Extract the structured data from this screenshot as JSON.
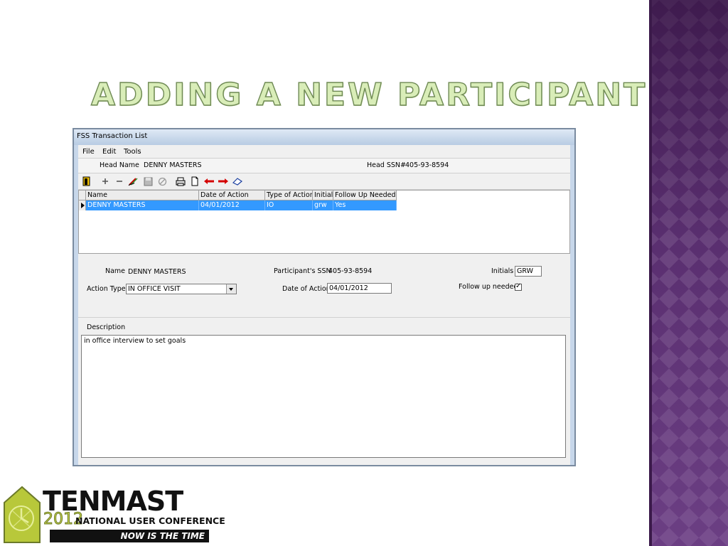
{
  "slide": {
    "title": "Adding a New Participant"
  },
  "window": {
    "title": "FSS Transaction List"
  },
  "menu": [
    "File",
    "Edit",
    "Tools"
  ],
  "header": {
    "head_name_label": "Head Name",
    "head_name_value": "DENNY MASTERS",
    "head_ssn_label": "Head SSN#",
    "head_ssn_value": "405-93-8594"
  },
  "toolbar": {
    "icons": [
      "exit-icon",
      "add-icon",
      "remove-icon",
      "edit-icon",
      "save-icon",
      "cancel-icon",
      "print-icon",
      "new-document-icon",
      "back-arrow-icon",
      "forward-arrow-icon",
      "eraser-icon"
    ]
  },
  "grid": {
    "columns": [
      "Name",
      "Date of Action",
      "Type of Action",
      "Initials",
      "Follow Up Needed"
    ],
    "rows": [
      [
        "DENNY MASTERS",
        "04/01/2012",
        "IO",
        "grw",
        "Yes"
      ]
    ]
  },
  "detail": {
    "name_label": "Name",
    "name_value": "DENNY MASTERS",
    "ssn_label": "Participant's SSN",
    "ssn_value": "405-93-8594",
    "initials_label": "Initials",
    "initials_value": "GRW",
    "action_type_label": "Action Type",
    "action_type_value": "IN OFFICE VISIT",
    "date_label": "Date of Action",
    "date_value": "04/01/2012",
    "follow_up_label": "Follow up needed",
    "follow_up_checked": true
  },
  "description": {
    "label": "Description",
    "text": "in office interview to set goals"
  },
  "logo": {
    "name": "TENMAST",
    "year": "2012",
    "subtitle": "NATIONAL USER CONFERENCE",
    "tagline": "NOW IS THE TIME"
  },
  "colors": {
    "selection": "#3399ff",
    "side_band": "#5a2f70",
    "title_fill": "#d9edb8"
  }
}
